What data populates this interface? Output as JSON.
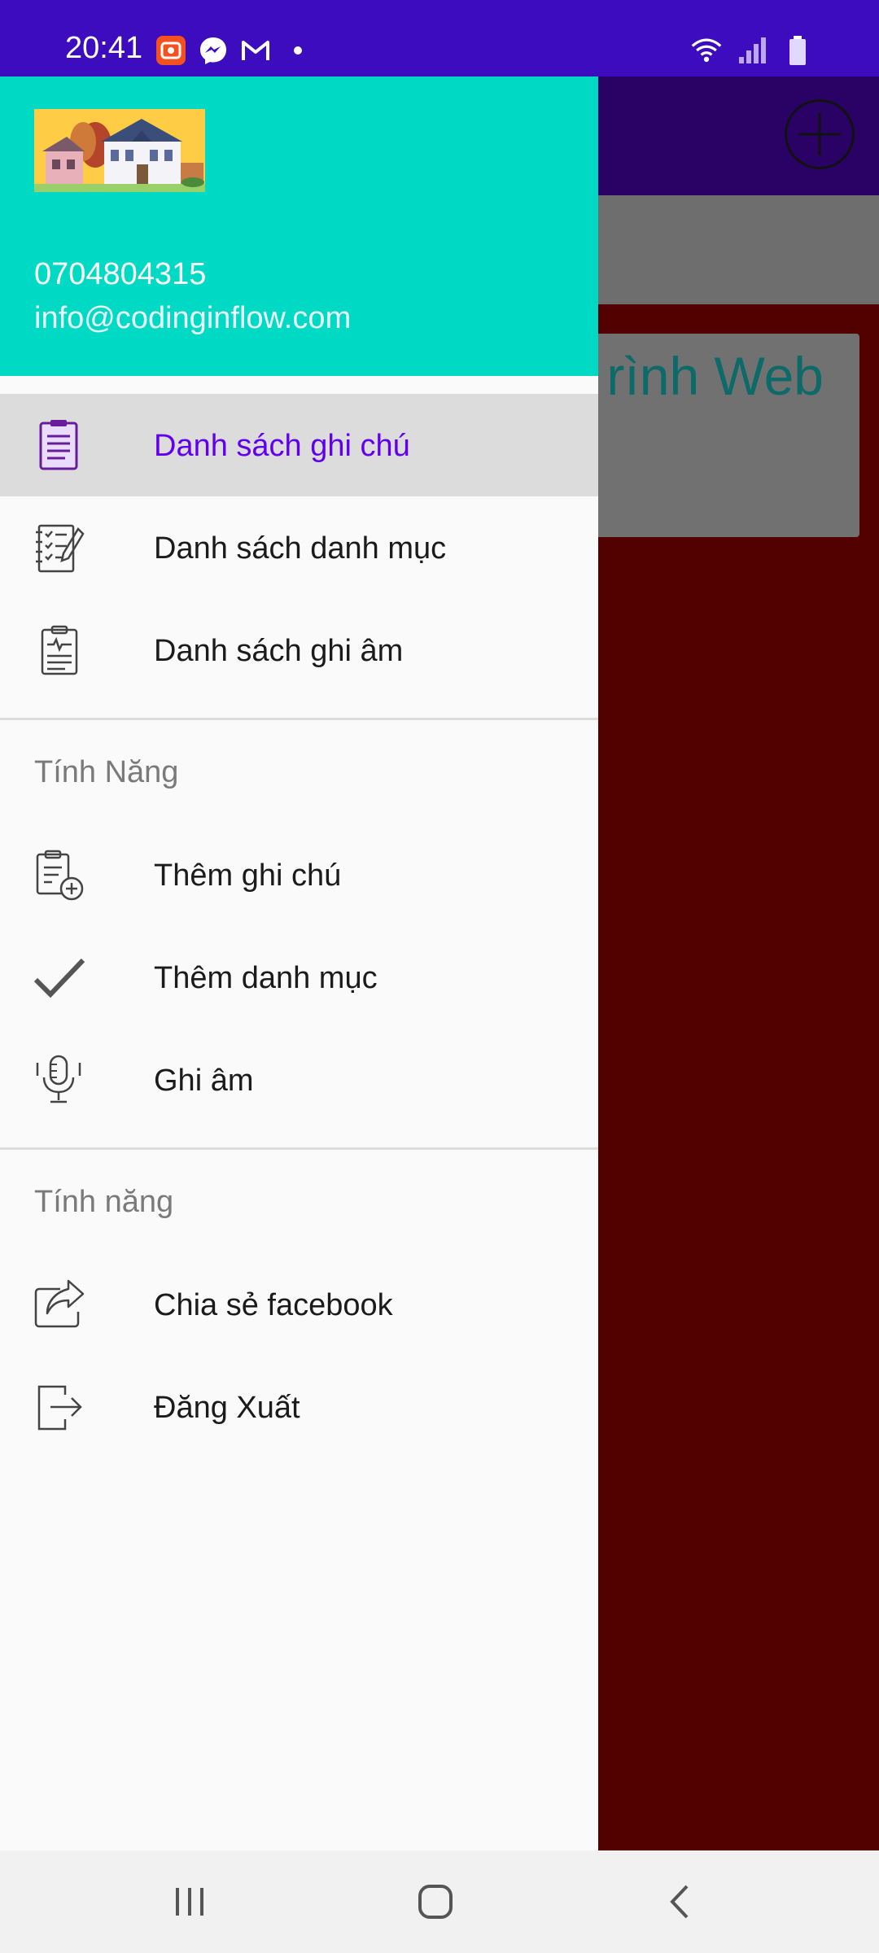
{
  "status_bar": {
    "time": "20:41",
    "left_icons": [
      "screen-recorder-icon",
      "messenger-icon",
      "gmail-icon",
      "notification-dot-icon"
    ],
    "right_icons": [
      "wifi-icon",
      "signal-icon",
      "battery-icon"
    ],
    "color": "#3d0cbf"
  },
  "background_app": {
    "toolbar_color": "#2a0265",
    "add_icon": "add-circle-icon",
    "card_title_visible": "rình Web"
  },
  "drawer": {
    "header": {
      "color": "#00d9c4",
      "image": "house-illustration",
      "phone": "0704804315",
      "email": "info@codinginflow.com"
    },
    "main_items": [
      {
        "label": "Danh sách ghi chú",
        "icon": "clipboard-icon",
        "active": true
      },
      {
        "label": "Danh sách danh mục",
        "icon": "checklist-notebook-icon",
        "active": false
      },
      {
        "label": "Danh sách ghi âm",
        "icon": "audio-report-icon",
        "active": false
      }
    ],
    "section1": {
      "title": "Tính Năng",
      "items": [
        {
          "label": "Thêm ghi chú",
          "icon": "add-note-icon"
        },
        {
          "label": "Thêm danh mục",
          "icon": "check-icon"
        },
        {
          "label": "Ghi âm",
          "icon": "microphone-icon"
        }
      ]
    },
    "section2": {
      "title": "Tính năng",
      "items": [
        {
          "label": "Chia sẻ facebook",
          "icon": "share-icon"
        },
        {
          "label": "Đăng Xuất",
          "icon": "logout-icon"
        }
      ]
    },
    "active_color": "#6200ee"
  },
  "nav_bar": {
    "buttons": [
      "recent-apps-icon",
      "home-icon",
      "back-icon"
    ]
  }
}
